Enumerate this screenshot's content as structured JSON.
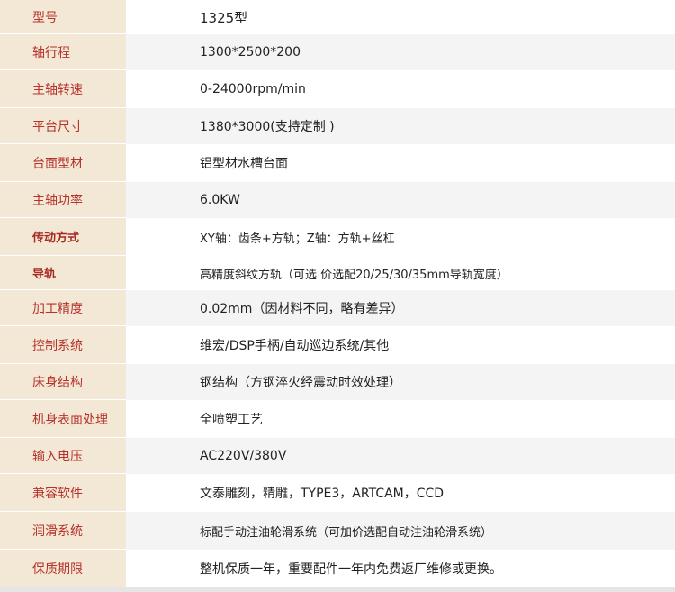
{
  "specs": {
    "rows": [
      {
        "label": "型号",
        "value": "1325型"
      },
      {
        "label": "轴行程",
        "value": "1300*2500*200"
      },
      {
        "label": "主轴转速",
        "value": "0-24000rpm/min"
      },
      {
        "label": "平台尺寸",
        "value": "1380*3000(支持定制 )"
      },
      {
        "label": "台面型材",
        "value": "铝型材水槽台面"
      },
      {
        "label": "主轴功率",
        "value": "6.0KW"
      },
      {
        "label": "传动方式",
        "value": "XY轴：齿条+方轨；Z轴：方轨+丝杠"
      },
      {
        "label": "导轨",
        "value": "高精度斜纹方轨（可选 价选配20/25/30/35mm导轨宽度）"
      },
      {
        "label": "加工精度",
        "value": "0.02mm（因材料不同，略有差异）"
      },
      {
        "label": "控制系统",
        "value": "维宏/DSP手柄/自动巡边系统/其他"
      },
      {
        "label": "床身结构",
        "value": "钢结构（方钢淬火经震动时效处理）"
      },
      {
        "label": "机身表面处理",
        "value": "全喷塑工艺"
      },
      {
        "label": "输入电压",
        "value": "AC220V/380V"
      },
      {
        "label": "兼容软件",
        "value": "文泰雕刻，精雕，TYPE3，ARTCAM，CCD"
      },
      {
        "label": "润滑系统",
        "value": "标配手动注油轮滑系统（可加价选配自动注油轮滑系统）"
      },
      {
        "label": "保质期限",
        "value": "整机保质一年，重要配件一年内免费返厂维修或更换。"
      }
    ]
  }
}
